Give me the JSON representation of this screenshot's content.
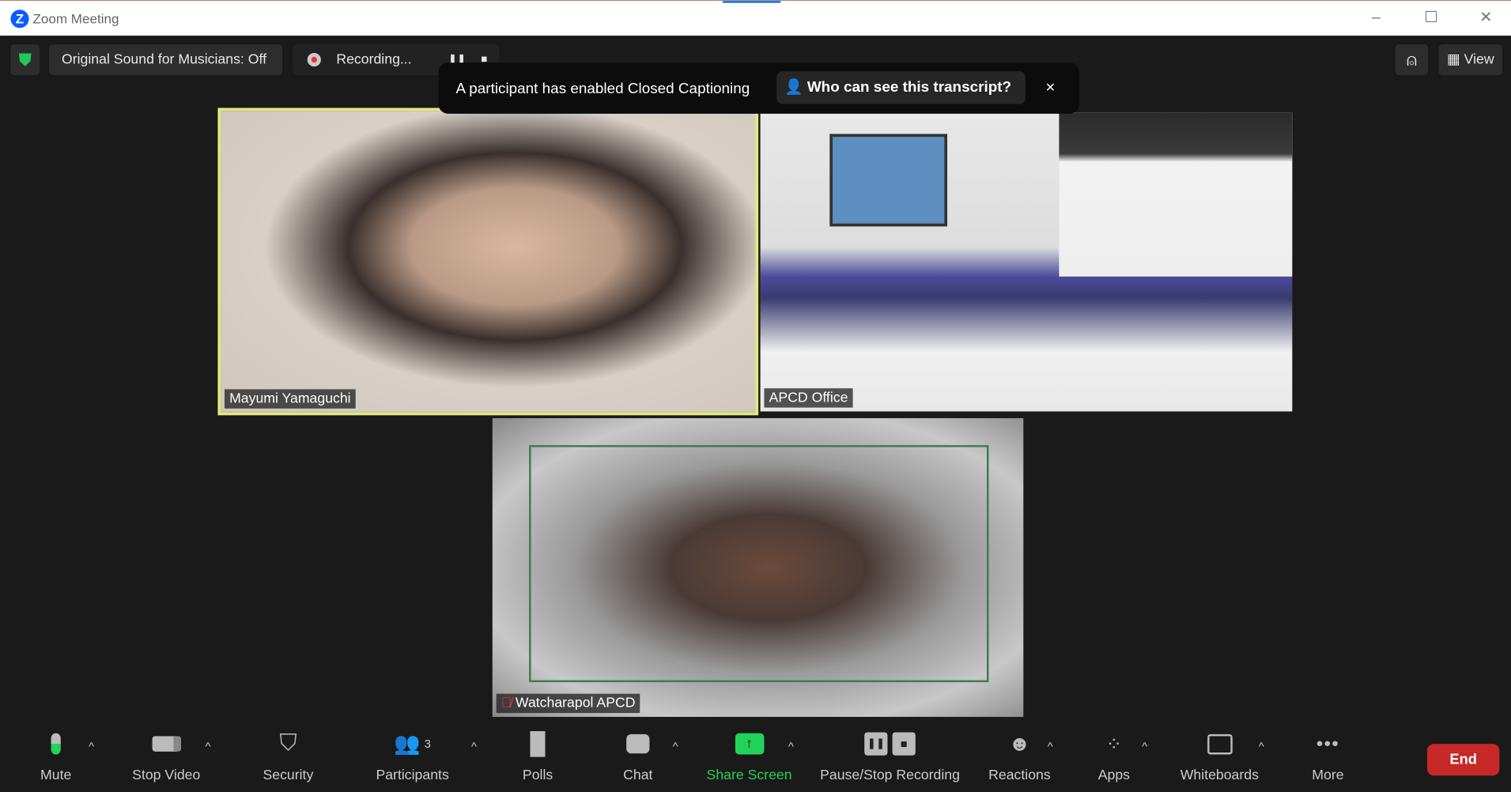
{
  "window": {
    "title": "Zoom Meeting",
    "logo": "Z"
  },
  "top": {
    "original_sound": "Original Sound for Musicians: Off",
    "recording": "Recording...",
    "view": "View"
  },
  "toast": {
    "message": "A participant has enabled Closed Captioning",
    "link": "Who can see this transcript?",
    "close": "×"
  },
  "participants": [
    {
      "name": "Mayumi Yamaguchi",
      "active_speaker": true
    },
    {
      "name": "APCD Office"
    },
    {
      "name": "Watcharapol APCD",
      "muted": true
    }
  ],
  "toolbar": {
    "mute": "Mute",
    "stop_video": "Stop Video",
    "security": "Security",
    "participants": "Participants",
    "participants_count": "3",
    "polls": "Polls",
    "chat": "Chat",
    "share_screen": "Share Screen",
    "pause_stop_recording": "Pause/Stop Recording",
    "reactions": "Reactions",
    "apps": "Apps",
    "whiteboards": "Whiteboards",
    "more": "More",
    "end": "End"
  },
  "colors": {
    "accent_green": "#22d35a",
    "end_red": "#c62828",
    "speaker_border": "#e2ec7a",
    "brand_blue": "#0b5cff"
  }
}
